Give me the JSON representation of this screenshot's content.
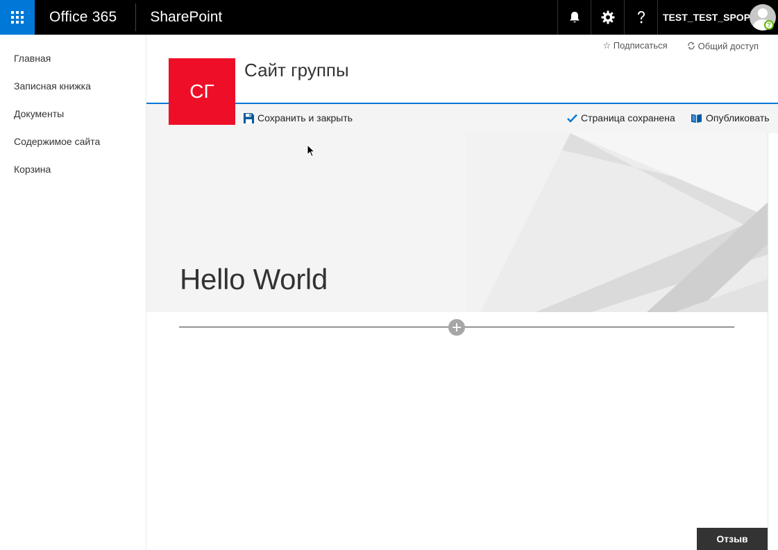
{
  "suite": {
    "brand": "Office 365",
    "app_name": "SharePoint",
    "user_name": "TEST_TEST_SPOP..."
  },
  "nav": {
    "items": [
      {
        "label": "Главная"
      },
      {
        "label": "Записная книжка"
      },
      {
        "label": "Документы"
      },
      {
        "label": "Содержимое сайта"
      },
      {
        "label": "Корзина"
      }
    ]
  },
  "header": {
    "logo_text": "СГ",
    "site_title": "Сайт группы",
    "follow_label": "☆ Подписаться",
    "share_label": "Общий доступ"
  },
  "commandbar": {
    "save_close_label": "Сохранить и закрыть",
    "saved_status": "Страница сохранена",
    "publish_label": "Опубликовать"
  },
  "hero": {
    "title": "Hello World"
  },
  "feedback": {
    "label": "Отзыв"
  },
  "colors": {
    "accent": "#0078d7",
    "logo_bg": "#ef0e28",
    "suitebar_bg": "#000000"
  }
}
